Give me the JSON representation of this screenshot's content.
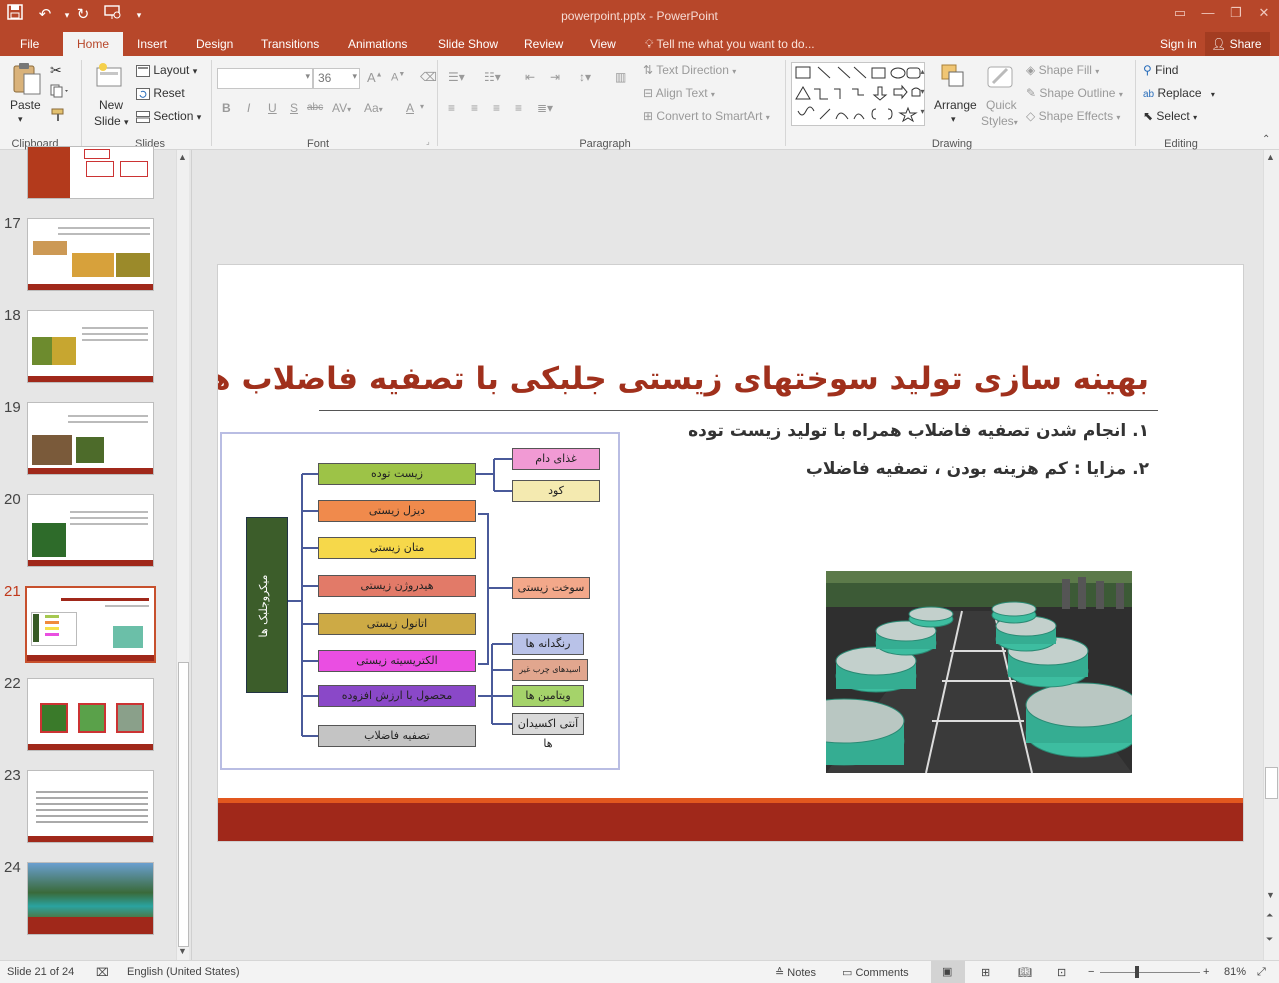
{
  "app": {
    "document_title": "powerpoint.pptx - PowerPoint",
    "accent": "#b7472a"
  },
  "tabs": [
    "File",
    "Home",
    "Insert",
    "Design",
    "Transitions",
    "Animations",
    "Slide Show",
    "Review",
    "View"
  ],
  "tell_me": "Tell me what you want to do...",
  "account": {
    "signin": "Sign in",
    "share": "Share"
  },
  "ribbon": {
    "clipboard": {
      "paste": "Paste",
      "group": "Clipboard"
    },
    "slides": {
      "new_slide_1": "New",
      "new_slide_2": "Slide",
      "layout": "Layout",
      "reset": "Reset",
      "section": "Section",
      "group": "Slides"
    },
    "font": {
      "size": "36",
      "group": "Font",
      "buttons": [
        "B",
        "I",
        "U",
        "S",
        "abc",
        "AV",
        "Aa"
      ]
    },
    "paragraph": {
      "text_direction": "Text Direction",
      "align_text": "Align Text",
      "smartart": "Convert to SmartArt",
      "group": "Paragraph"
    },
    "drawing": {
      "arrange": "Arrange",
      "quick_styles_1": "Quick",
      "quick_styles_2": "Styles",
      "shape_fill": "Shape Fill",
      "shape_outline": "Shape Outline",
      "shape_effects": "Shape Effects",
      "group": "Drawing"
    },
    "editing": {
      "find": "Find",
      "replace": "Replace",
      "select": "Select",
      "group": "Editing"
    }
  },
  "thumbnails": [
    {
      "num": "17"
    },
    {
      "num": "18"
    },
    {
      "num": "19"
    },
    {
      "num": "20"
    },
    {
      "num": "21",
      "selected": true
    },
    {
      "num": "22"
    },
    {
      "num": "23"
    },
    {
      "num": "24"
    }
  ],
  "slide": {
    "title": "بهینه سازی تولید سوختهای زیستی جلبکی با تصفیه فاضلاب ها",
    "bullet1": "۱. انجام شدن تصفیه فاضلاب همراه با تولید زیست توده",
    "bullet2": "۲. مزایا : کم هزینه بودن ، تصفیه فاضلاب",
    "diagram": {
      "root": "میکروجلبک ها",
      "middle": [
        "زیست توده",
        "دیزل زیستی",
        "متان زیستی",
        "هیدروژن زیستی",
        "اتانول زیستی",
        "الکتریسیته زیستی",
        "محصول با ارزش افزوده",
        "تصفیه فاضلاب"
      ],
      "right": [
        "غذای دام",
        "کود",
        "سوخت زیستی",
        "رنگدانه ها",
        "اسیدهای چرب غیر اشباع",
        "ویتامین ها",
        "آنتی اکسیدان ها"
      ]
    }
  },
  "status": {
    "slide_of": "Slide 21 of 24",
    "language": "English (United States)",
    "notes": "Notes",
    "comments": "Comments",
    "zoom": "81%"
  }
}
